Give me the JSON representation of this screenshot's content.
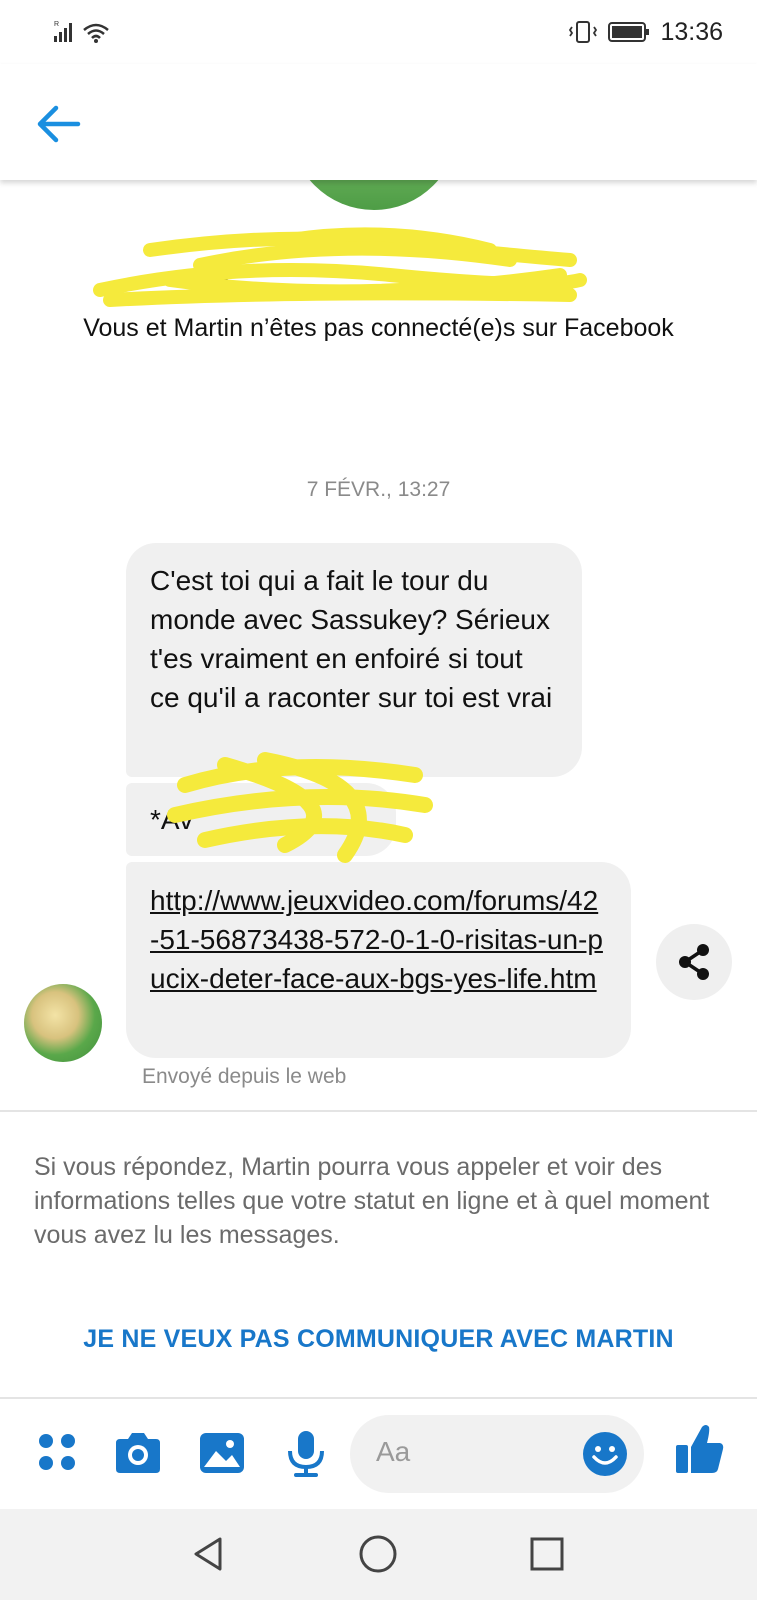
{
  "status_bar": {
    "time": "13:36",
    "icons": [
      "signal-icon",
      "wifi-icon",
      "vibrate-icon",
      "battery-icon"
    ]
  },
  "header": {
    "back_icon": "back-arrow-icon"
  },
  "conversation": {
    "not_connected_text": "Vous et Martin n’êtes pas connecté(e)s sur Facebook",
    "timestamp": "7 FÉVR., 13:27",
    "messages": [
      {
        "text": "C'est toi qui a fait le tour du monde avec Sassukey? Sérieux t'es vraiment en enfoiré si tout ce qu'il a raconter sur toi est vrai"
      },
      {
        "text": "*Av"
      },
      {
        "text": "http://www.jeuxvideo.com/forums/42-51-56873438-572-0-1-0-risitas-un-pucix-deter-face-aux-bgs-yes-life.htm"
      }
    ],
    "sent_from": "Envoyé depuis le web"
  },
  "notice": {
    "text": "Si vous répondez, Martin pourra vous appeler et voir des informations telles que votre statut en ligne et à quel moment vous avez lu les messages.",
    "action": "JE NE VEUX PAS COMMUNIQUER AVEC MARTIN"
  },
  "composer": {
    "placeholder": "Aa",
    "icons": [
      "apps-icon",
      "camera-icon",
      "image-icon",
      "microphone-icon",
      "emoji-icon",
      "thumbs-up-icon"
    ]
  },
  "navigation": {
    "icons": [
      "nav-back-icon",
      "nav-home-icon",
      "nav-recents-icon"
    ]
  },
  "colors": {
    "accent": "#1877c9",
    "bubble": "#f0f0f0",
    "redaction": "#f5ea3c"
  }
}
